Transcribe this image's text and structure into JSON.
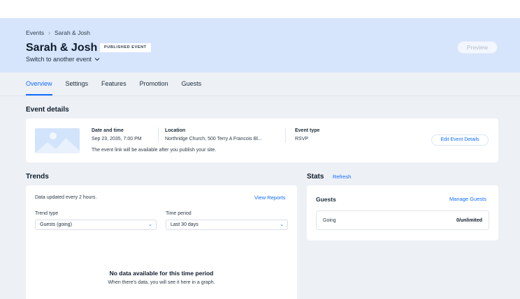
{
  "breadcrumb": {
    "parent": "Events",
    "current": "Sarah & Josh"
  },
  "event": {
    "title": "Sarah & Josh",
    "status_badge": "PUBLISHED EVENT",
    "switch_label": "Switch to another event"
  },
  "header": {
    "preview_label": "Preview"
  },
  "tabs": [
    {
      "label": "Overview",
      "active": true
    },
    {
      "label": "Settings",
      "active": false
    },
    {
      "label": "Features",
      "active": false
    },
    {
      "label": "Promotion",
      "active": false
    },
    {
      "label": "Guests",
      "active": false
    }
  ],
  "event_details": {
    "section_title": "Event details",
    "date_label": "Date and time",
    "date_value": "Sep 23, 2035, 7:00 PM",
    "location_label": "Location",
    "location_value": "Northridge Church, 500 Terry A Francois Bl...",
    "type_label": "Event type",
    "type_value": "RSVP",
    "publish_note": "The event link will be available after you publish your site.",
    "edit_label": "Edit Event Details"
  },
  "trends": {
    "section_title": "Trends",
    "update_note": "Data updated every 2 hours.",
    "view_reports_label": "View Reports",
    "trend_type_label": "Trend type",
    "trend_type_value": "Guests (going)",
    "time_period_label": "Time period",
    "time_period_value": "Last 30 days",
    "no_data_title": "No data available for this time period",
    "no_data_sub": "When there's data, you will see it here in a graph."
  },
  "stats": {
    "section_title": "Stats",
    "refresh_label": "Refresh",
    "guests_title": "Guests",
    "manage_label": "Manage Guests",
    "going_label": "Going",
    "going_value": "0/unlimited"
  },
  "colors": {
    "accent": "#116dff",
    "header_bg": "#d6e4fc",
    "page_bg": "#edf0f5"
  }
}
